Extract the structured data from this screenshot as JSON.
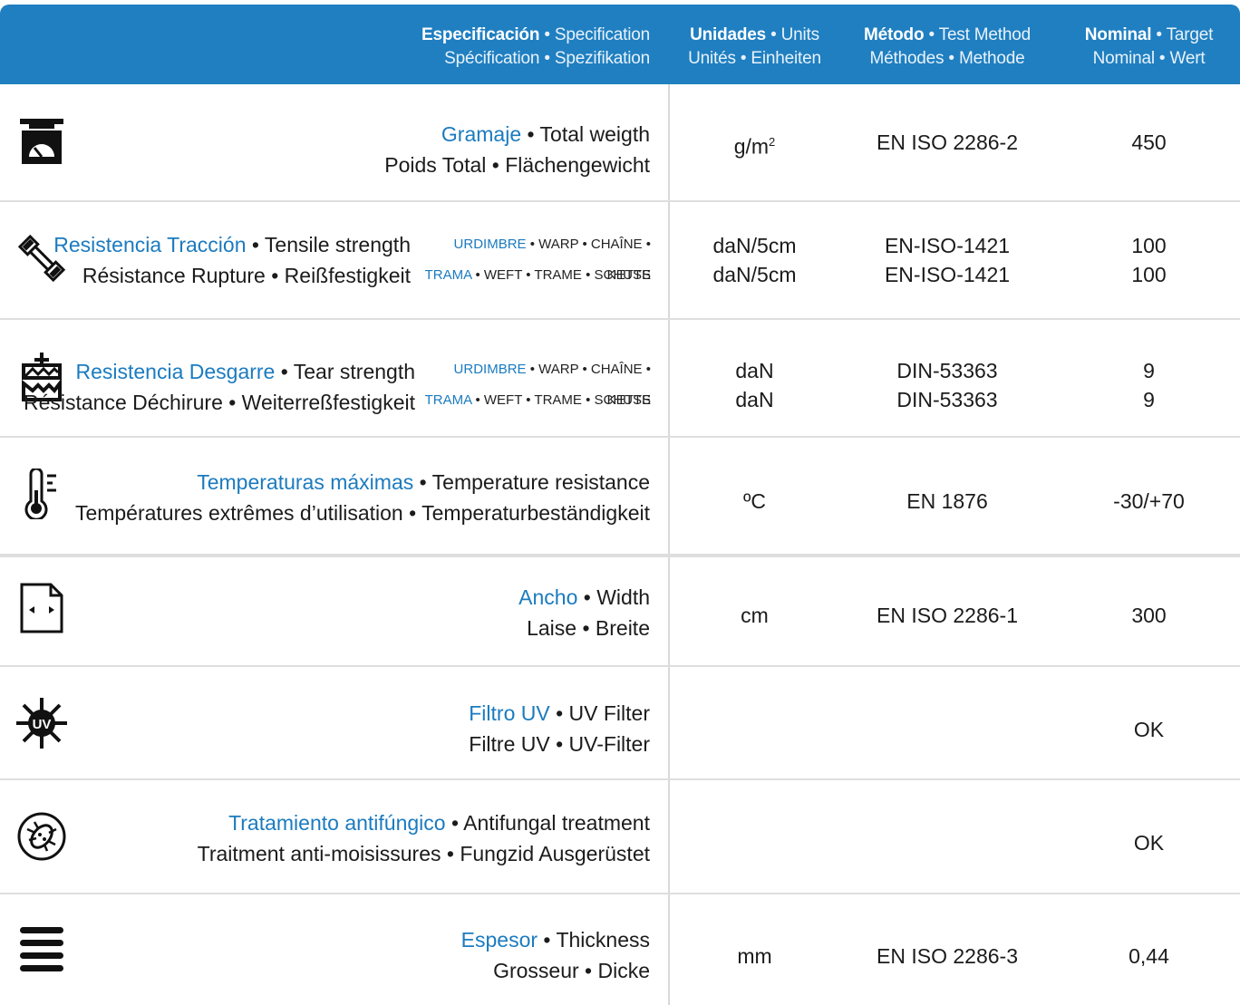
{
  "header": {
    "spec": {
      "bold": "Especificación",
      "rest": " • Specification",
      "line2": "Spécification • Spezifikation"
    },
    "units": {
      "bold": "Unidades",
      "rest": " • Units",
      "line2": "Unités • Einheiten"
    },
    "method": {
      "bold": "Método",
      "rest": " • Test Method",
      "line2": "Méthodes • Methode"
    },
    "nominal": {
      "bold": "Nominal",
      "rest": " • Target",
      "line2": "Nominal • Wert"
    }
  },
  "warp_label": {
    "accent": "URDIMBRE",
    "rest": " • WARP • CHAÎNE • KETTE"
  },
  "weft_label": {
    "accent": "TRAMA",
    "rest": " • WEFT • TRAME • SCHUSS"
  },
  "rows": [
    {
      "icon": "scale-icon",
      "title": "Gramaje",
      "title_rest": " • Total weigth",
      "line2": "Poids Total • Flächengewicht",
      "unit": "g/m",
      "unit_sup": "2",
      "method": "EN ISO 2286-2",
      "nominal": "450"
    },
    {
      "icon": "tensile-specimen-icon",
      "title": "Resistencia Tracción",
      "title_rest": " • Tensile strength",
      "line2": "Résistance Rupture • Reißfestigkeit",
      "unit": "daN/5cm",
      "unit2": "daN/5cm",
      "method": "EN-ISO-1421",
      "method2": "EN-ISO-1421",
      "nominal": "100",
      "nominal2": "100"
    },
    {
      "icon": "tear-icon",
      "title": "Resistencia Desgarre",
      "title_rest": " • Tear strength",
      "line2": "Résistance Déchirure  • Weiterreßfestigkeit",
      "unit": "daN",
      "unit2": "daN",
      "method": "DIN-53363",
      "method2": "DIN-53363",
      "nominal": "9",
      "nominal2": "9"
    },
    {
      "icon": "thermometer-icon",
      "title": "Temperaturas máximas",
      "title_rest": " • Temperature resistance",
      "line2": "Températures extrêmes d’utilisation • Temperaturbeständigkeit",
      "unit": "ºC",
      "method": "EN 1876",
      "nominal": "-30/+70"
    },
    {
      "icon": "width-icon",
      "title": "Ancho",
      "title_rest": " • Width",
      "line2": "Laise • Breite",
      "unit": "cm",
      "method": "EN ISO 2286-1",
      "nominal": "300"
    },
    {
      "icon": "uv-sun-icon",
      "icon_text": "UV",
      "title": "Filtro UV",
      "title_rest": " • UV Filter",
      "line2": "Filtre UV • UV-Filter",
      "unit": "",
      "method": "",
      "nominal": "OK"
    },
    {
      "icon": "fungus-icon",
      "title": "Tratamiento antifúngico",
      "title_rest": " • Antifungal treatment",
      "line2": "Traitment anti-moisissures • Fungzid Ausgerüstet",
      "unit": "",
      "method": "",
      "nominal": "OK"
    },
    {
      "icon": "thickness-layers-icon",
      "title": "Espesor",
      "title_rest": " • Thickness",
      "line2": "Grosseur • Dicke",
      "unit": "mm",
      "method": "EN ISO 2286-3",
      "nominal": "0,44"
    }
  ]
}
